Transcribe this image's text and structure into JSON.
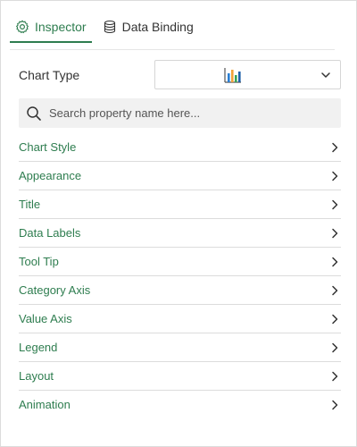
{
  "tabs": [
    {
      "label": "Inspector",
      "icon": "gear-icon",
      "active": true
    },
    {
      "label": "Data Binding",
      "icon": "database-icon",
      "active": false
    }
  ],
  "chart_type": {
    "label": "Chart Type",
    "selected_icon": "bar-chart-icon"
  },
  "search": {
    "placeholder": "Search property name here..."
  },
  "properties": [
    {
      "label": "Chart Style"
    },
    {
      "label": "Appearance"
    },
    {
      "label": "Title"
    },
    {
      "label": "Data Labels"
    },
    {
      "label": "Tool Tip"
    },
    {
      "label": "Category Axis"
    },
    {
      "label": "Value Axis"
    },
    {
      "label": "Legend"
    },
    {
      "label": "Layout"
    },
    {
      "label": "Animation"
    }
  ],
  "colors": {
    "accent": "#2e7d4f",
    "text": "#333333",
    "search_bg": "#f1f1f1"
  }
}
